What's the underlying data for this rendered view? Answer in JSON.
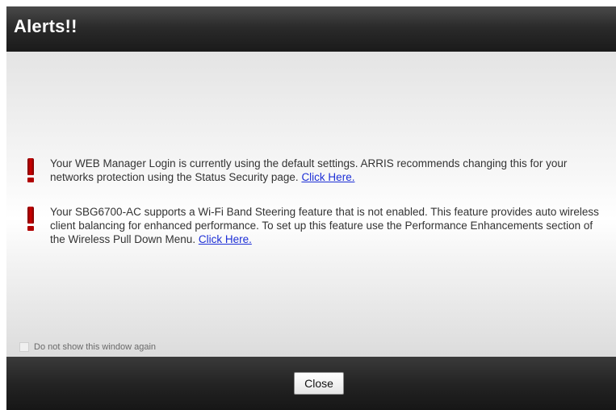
{
  "dialog": {
    "title": "Alerts!!"
  },
  "alerts": [
    {
      "icon": "exclamation-icon",
      "text": "Your WEB Manager Login is currently using the default settings. ARRIS recommends changing this for your networks protection using the Status Security page. ",
      "link": "Click Here."
    },
    {
      "icon": "exclamation-icon",
      "text": "Your SBG6700-AC supports a Wi-Fi Band Steering feature that is not enabled. This feature provides auto wireless client balancing for enhanced performance. To set up this feature use the Performance Enhancements section of the Wireless Pull Down Menu. ",
      "link": "Click Here."
    }
  ],
  "dont_show": {
    "label": "Do not show this window again",
    "checked": false
  },
  "footer": {
    "close_label": "Close"
  },
  "colors": {
    "title_bar": "#2b2b2b",
    "alert_icon": "#c00000",
    "link": "#1d2fd6"
  }
}
